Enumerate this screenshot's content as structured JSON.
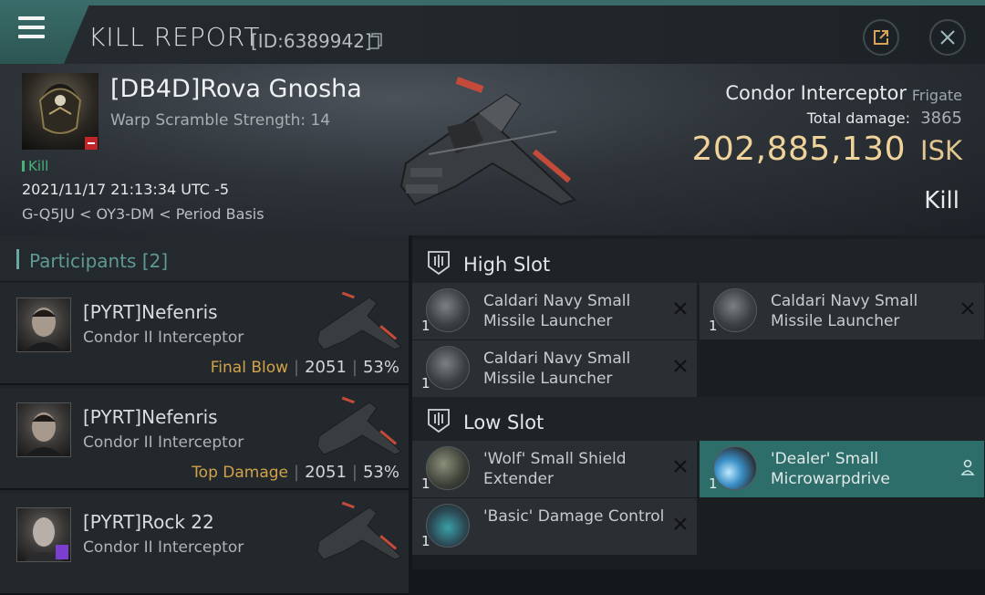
{
  "topbar": {
    "title": "KILL REPORT",
    "id_label": "[ID:6389942]",
    "icons": {
      "menu": "hamburger-icon",
      "copy": "copy-icon",
      "export": "external-link-icon",
      "close": "close-icon"
    }
  },
  "victim": {
    "name": "[DB4D]Rova Gnosha",
    "warp_scramble": "Warp Scramble Strength: 14",
    "kill_tag": "Kill",
    "datetime": "2021/11/17 21:13:34 UTC -5",
    "location": "G-Q5JU < OY3-DM < Period Basis",
    "ship_name": "Condor Interceptor",
    "ship_class": "Frigate",
    "total_damage_label": "Total damage:",
    "total_damage": "3865",
    "isk_value": "202,885,130",
    "isk_label": "ISK",
    "result": "Kill"
  },
  "participants": {
    "title": "Participants [2]",
    "rows": [
      {
        "name": "[PYRT]Nefenris",
        "ship": "Condor II Interceptor",
        "tag": "Final Blow",
        "damage": "2051",
        "percent": "53%"
      },
      {
        "name": "[PYRT]Nefenris",
        "ship": "Condor II Interceptor",
        "tag": "Top Damage",
        "damage": "2051",
        "percent": "53%"
      },
      {
        "name": "[PYRT]Rock 22",
        "ship": "Condor II Interceptor",
        "tag": "",
        "damage": "",
        "percent": ""
      }
    ]
  },
  "slots": {
    "high": {
      "title": "High Slot",
      "items": [
        {
          "qty": "1",
          "name": "Caldari Navy Small Missile Launcher"
        },
        {
          "qty": "1",
          "name": "Caldari Navy Small Missile Launcher"
        },
        {
          "qty": "1",
          "name": "Caldari Navy Small Missile Launcher"
        }
      ]
    },
    "low": {
      "title": "Low Slot",
      "items": [
        {
          "qty": "1",
          "name": "'Wolf' Small Shield Extender"
        },
        {
          "qty": "1",
          "name": "'Dealer' Small Microwarpdrive"
        },
        {
          "qty": "1",
          "name": "'Basic' Damage Control"
        }
      ]
    }
  },
  "colors": {
    "accent": "#3b6b68",
    "isk": "#f0d39a",
    "final_blow": "#d2a24a",
    "highlight_item": "#2e6e6a"
  }
}
